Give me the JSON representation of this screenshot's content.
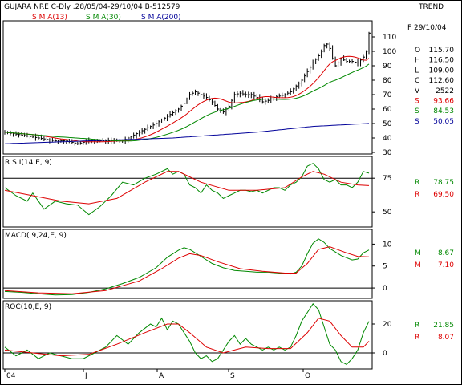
{
  "header": {
    "title": "GUJARA NRE C-Dly .28/05/04-29/10/04  B-512579",
    "right_label": "TREND",
    "legend": [
      {
        "label": "S M A(13)",
        "color": "#dd0000"
      },
      {
        "label": "S M A(30)",
        "color": "#008800"
      },
      {
        "label": "S M A(200)",
        "color": "#000099"
      }
    ]
  },
  "readouts": {
    "date": "F 29/10/04",
    "ohlc": [
      {
        "k": "O",
        "v": "115.70",
        "color": "#000000"
      },
      {
        "k": "H",
        "v": "116.50",
        "color": "#000000"
      },
      {
        "k": "L",
        "v": "109.00",
        "color": "#000000"
      },
      {
        "k": "C",
        "v": "112.60",
        "color": "#000000"
      },
      {
        "k": "V",
        "v": "2522",
        "color": "#000000"
      },
      {
        "k": "S",
        "v": "93.66",
        "color": "#dd0000"
      },
      {
        "k": "S",
        "v": "84.53",
        "color": "#008800"
      },
      {
        "k": "S",
        "v": "50.05",
        "color": "#000099"
      }
    ],
    "rsi": [
      {
        "k": "R",
        "v": "78.75",
        "color": "#008800"
      },
      {
        "k": "R",
        "v": "69.50",
        "color": "#dd0000"
      }
    ],
    "macd": [
      {
        "k": "M",
        "v": "8.67",
        "color": "#008800"
      },
      {
        "k": "M",
        "v": "7.10",
        "color": "#dd0000"
      }
    ],
    "roc": [
      {
        "k": "R",
        "v": "21.85",
        "color": "#008800"
      },
      {
        "k": "R",
        "v": "8.07",
        "color": "#dd0000"
      }
    ]
  },
  "chart_data": [
    {
      "type": "candlestick",
      "panel": "price",
      "ylim": [
        30,
        120
      ],
      "yticks": [
        30,
        40,
        50,
        60,
        70,
        80,
        90,
        100,
        110
      ],
      "x_labels": [
        "04",
        "J",
        "A",
        "S",
        "O"
      ],
      "n": 107,
      "close_anchors": [
        [
          0,
          44
        ],
        [
          6,
          42
        ],
        [
          12,
          40
        ],
        [
          18,
          38
        ],
        [
          22,
          38
        ],
        [
          26,
          36
        ],
        [
          30,
          38
        ],
        [
          34,
          38
        ],
        [
          38,
          38
        ],
        [
          42,
          38
        ],
        [
          46,
          42
        ],
        [
          50,
          46
        ],
        [
          54,
          50
        ],
        [
          58,
          55
        ],
        [
          62,
          60
        ],
        [
          64,
          64
        ],
        [
          66,
          70
        ],
        [
          68,
          72
        ],
        [
          70,
          70
        ],
        [
          72,
          68
        ],
        [
          74,
          65
        ],
        [
          76,
          60
        ],
        [
          78,
          58
        ],
        [
          80,
          62
        ],
        [
          82,
          70
        ],
        [
          84,
          71
        ],
        [
          86,
          70
        ],
        [
          88,
          70
        ],
        [
          90,
          68
        ],
        [
          92,
          65
        ],
        [
          94,
          66
        ],
        [
          96,
          68
        ],
        [
          98,
          69
        ],
        [
          100,
          70
        ],
        [
          102,
          72
        ],
        [
          104,
          76
        ],
        [
          106,
          80
        ],
        [
          108,
          86
        ],
        [
          110,
          92
        ],
        [
          112,
          97
        ],
        [
          113,
          100
        ],
        [
          114,
          104
        ],
        [
          115,
          105
        ],
        [
          116,
          102
        ],
        [
          117,
          95
        ],
        [
          118,
          90
        ],
        [
          119,
          92
        ],
        [
          120,
          95
        ],
        [
          122,
          93
        ],
        [
          124,
          93
        ],
        [
          126,
          92
        ],
        [
          128,
          96
        ],
        [
          129,
          100
        ],
        [
          130,
          112.6
        ]
      ],
      "x_index_range": [
        0,
        130
      ],
      "series": [
        {
          "name": "S M A(13)",
          "color": "#dd0000",
          "last": 93.66
        },
        {
          "name": "S M A(30)",
          "color": "#008800",
          "last": 84.53
        },
        {
          "name": "S M A(200)",
          "color": "#000099",
          "last": 50.05
        }
      ],
      "sma200_path": [
        [
          0,
          36
        ],
        [
          30,
          38
        ],
        [
          60,
          40
        ],
        [
          90,
          44
        ],
        [
          110,
          48
        ],
        [
          130,
          50.05
        ]
      ]
    },
    {
      "type": "line",
      "panel": "rsi",
      "title": "R S I(14,E, 9)",
      "ylim": [
        40,
        90
      ],
      "yticks": [
        50,
        75
      ],
      "hline": 75,
      "series": [
        {
          "name": "R",
          "color": "#008800",
          "points": [
            [
              0,
              68
            ],
            [
              4,
              62
            ],
            [
              8,
              58
            ],
            [
              10,
              64
            ],
            [
              14,
              52
            ],
            [
              18,
              58
            ],
            [
              22,
              56
            ],
            [
              26,
              55
            ],
            [
              30,
              48
            ],
            [
              34,
              54
            ],
            [
              38,
              62
            ],
            [
              42,
              72
            ],
            [
              46,
              70
            ],
            [
              50,
              75
            ],
            [
              54,
              78
            ],
            [
              58,
              82
            ],
            [
              60,
              78
            ],
            [
              62,
              80
            ],
            [
              64,
              78
            ],
            [
              66,
              70
            ],
            [
              68,
              68
            ],
            [
              70,
              64
            ],
            [
              72,
              70
            ],
            [
              74,
              66
            ],
            [
              76,
              64
            ],
            [
              78,
              60
            ],
            [
              80,
              62
            ],
            [
              82,
              64
            ],
            [
              84,
              66
            ],
            [
              86,
              66
            ],
            [
              88,
              65
            ],
            [
              90,
              66
            ],
            [
              92,
              64
            ],
            [
              94,
              66
            ],
            [
              96,
              68
            ],
            [
              98,
              68
            ],
            [
              100,
              66
            ],
            [
              102,
              70
            ],
            [
              104,
              72
            ],
            [
              106,
              76
            ],
            [
              108,
              84
            ],
            [
              110,
              86
            ],
            [
              112,
              82
            ],
            [
              114,
              74
            ],
            [
              116,
              72
            ],
            [
              118,
              74
            ],
            [
              120,
              70
            ],
            [
              122,
              70
            ],
            [
              124,
              68
            ],
            [
              126,
              72
            ],
            [
              128,
              80
            ],
            [
              130,
              78.75
            ]
          ]
        },
        {
          "name": "R",
          "color": "#dd0000",
          "points": [
            [
              0,
              66
            ],
            [
              10,
              62
            ],
            [
              20,
              58
            ],
            [
              30,
              56
            ],
            [
              40,
              60
            ],
            [
              50,
              72
            ],
            [
              58,
              80
            ],
            [
              62,
              80
            ],
            [
              70,
              72
            ],
            [
              80,
              66
            ],
            [
              90,
              66
            ],
            [
              100,
              68
            ],
            [
              106,
              76
            ],
            [
              110,
              80
            ],
            [
              114,
              78
            ],
            [
              120,
              72
            ],
            [
              126,
              70
            ],
            [
              130,
              69.5
            ]
          ]
        }
      ]
    },
    {
      "type": "line",
      "panel": "macd",
      "title": "MACD( 9,24,E, 9)",
      "ylim": [
        -2,
        13
      ],
      "yticks": [
        0,
        5,
        10
      ],
      "hline": 0,
      "series": [
        {
          "name": "M",
          "color": "#008800",
          "points": [
            [
              0,
              -0.8
            ],
            [
              6,
              -1.0
            ],
            [
              12,
              -1.3
            ],
            [
              18,
              -1.6
            ],
            [
              24,
              -1.5
            ],
            [
              30,
              -1.0
            ],
            [
              36,
              -0.2
            ],
            [
              42,
              1.0
            ],
            [
              48,
              2.4
            ],
            [
              54,
              4.6
            ],
            [
              58,
              7.0
            ],
            [
              62,
              8.6
            ],
            [
              64,
              9.2
            ],
            [
              66,
              8.8
            ],
            [
              70,
              7.2
            ],
            [
              74,
              5.6
            ],
            [
              78,
              4.6
            ],
            [
              82,
              4.0
            ],
            [
              86,
              3.8
            ],
            [
              90,
              3.6
            ],
            [
              94,
              3.6
            ],
            [
              98,
              3.4
            ],
            [
              102,
              3.2
            ],
            [
              104,
              3.6
            ],
            [
              106,
              5.0
            ],
            [
              108,
              7.8
            ],
            [
              110,
              10.2
            ],
            [
              112,
              11.2
            ],
            [
              114,
              10.4
            ],
            [
              116,
              9.0
            ],
            [
              118,
              8.2
            ],
            [
              120,
              7.4
            ],
            [
              124,
              6.4
            ],
            [
              126,
              6.6
            ],
            [
              128,
              8.0
            ],
            [
              130,
              8.67
            ]
          ]
        },
        {
          "name": "M",
          "color": "#dd0000",
          "points": [
            [
              0,
              -0.6
            ],
            [
              12,
              -1.1
            ],
            [
              24,
              -1.3
            ],
            [
              36,
              -0.6
            ],
            [
              48,
              1.6
            ],
            [
              56,
              4.4
            ],
            [
              62,
              6.8
            ],
            [
              66,
              7.8
            ],
            [
              70,
              7.4
            ],
            [
              76,
              6.0
            ],
            [
              84,
              4.4
            ],
            [
              92,
              3.8
            ],
            [
              100,
              3.4
            ],
            [
              104,
              3.4
            ],
            [
              108,
              5.6
            ],
            [
              112,
              8.8
            ],
            [
              116,
              9.4
            ],
            [
              122,
              8.0
            ],
            [
              126,
              7.2
            ],
            [
              130,
              7.1
            ]
          ]
        }
      ]
    },
    {
      "type": "line",
      "panel": "roc",
      "title": "ROC(10,E, 9)",
      "ylim": [
        -10,
        35
      ],
      "yticks": [
        0,
        20
      ],
      "hline": 0,
      "series": [
        {
          "name": "R",
          "color": "#008800",
          "points": [
            [
              0,
              4
            ],
            [
              4,
              -2
            ],
            [
              8,
              2
            ],
            [
              12,
              -4
            ],
            [
              16,
              0
            ],
            [
              20,
              -2
            ],
            [
              24,
              -4
            ],
            [
              28,
              -4
            ],
            [
              32,
              0
            ],
            [
              36,
              4
            ],
            [
              40,
              12
            ],
            [
              44,
              6
            ],
            [
              48,
              14
            ],
            [
              52,
              20
            ],
            [
              54,
              18
            ],
            [
              56,
              24
            ],
            [
              58,
              16
            ],
            [
              60,
              22
            ],
            [
              62,
              20
            ],
            [
              64,
              14
            ],
            [
              66,
              8
            ],
            [
              68,
              0
            ],
            [
              70,
              -4
            ],
            [
              72,
              -2
            ],
            [
              74,
              -6
            ],
            [
              76,
              -4
            ],
            [
              78,
              2
            ],
            [
              80,
              8
            ],
            [
              82,
              12
            ],
            [
              84,
              6
            ],
            [
              86,
              10
            ],
            [
              88,
              6
            ],
            [
              90,
              4
            ],
            [
              92,
              2
            ],
            [
              94,
              4
            ],
            [
              96,
              2
            ],
            [
              98,
              4
            ],
            [
              100,
              2
            ],
            [
              102,
              4
            ],
            [
              104,
              12
            ],
            [
              106,
              22
            ],
            [
              108,
              28
            ],
            [
              110,
              34
            ],
            [
              112,
              30
            ],
            [
              114,
              18
            ],
            [
              116,
              6
            ],
            [
              118,
              2
            ],
            [
              120,
              -6
            ],
            [
              122,
              -8
            ],
            [
              124,
              -4
            ],
            [
              126,
              2
            ],
            [
              128,
              14
            ],
            [
              130,
              21.85
            ]
          ]
        },
        {
          "name": "R",
          "color": "#dd0000",
          "points": [
            [
              0,
              2
            ],
            [
              10,
              0
            ],
            [
              20,
              -2
            ],
            [
              30,
              -1
            ],
            [
              40,
              6
            ],
            [
              50,
              14
            ],
            [
              58,
              20
            ],
            [
              62,
              20
            ],
            [
              66,
              14
            ],
            [
              72,
              4
            ],
            [
              78,
              0
            ],
            [
              86,
              4
            ],
            [
              94,
              3
            ],
            [
              102,
              3
            ],
            [
              108,
              14
            ],
            [
              112,
              24
            ],
            [
              116,
              22
            ],
            [
              120,
              12
            ],
            [
              124,
              4
            ],
            [
              128,
              4
            ],
            [
              130,
              8.07
            ]
          ]
        }
      ]
    }
  ]
}
